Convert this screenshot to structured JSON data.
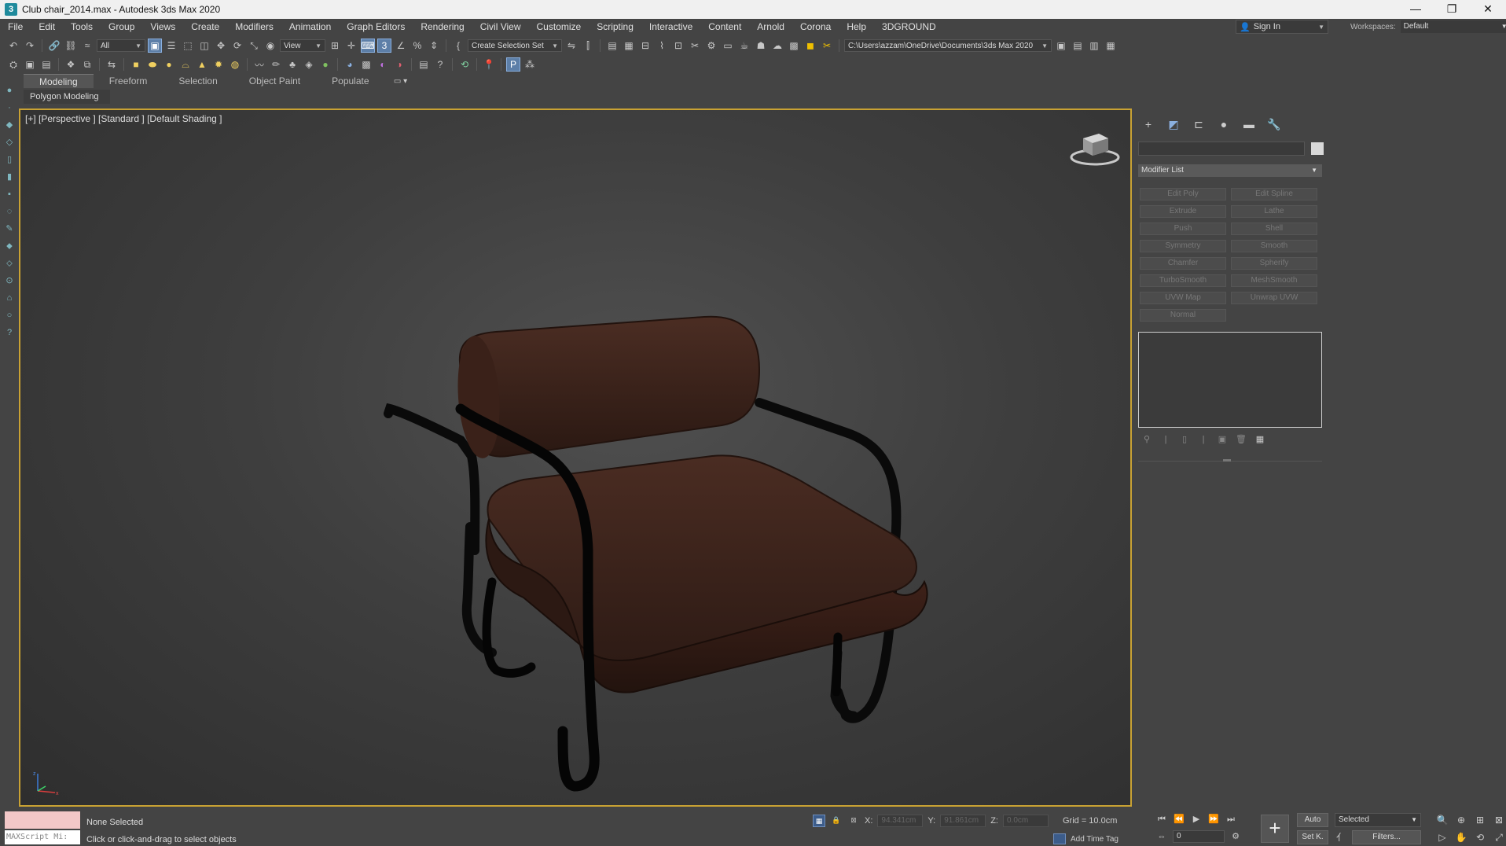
{
  "window": {
    "title": "Club chair_2014.max - Autodesk 3ds Max 2020",
    "minimize": "—",
    "restore": "❐",
    "close": "✕"
  },
  "menu": [
    "File",
    "Edit",
    "Tools",
    "Group",
    "Views",
    "Create",
    "Modifiers",
    "Animation",
    "Graph Editors",
    "Rendering",
    "Civil View",
    "Customize",
    "Scripting",
    "Interactive",
    "Content",
    "Arnold",
    "Corona",
    "Help",
    "3DGROUND"
  ],
  "account": {
    "sign_in": "Sign In"
  },
  "workspaces": {
    "label": "Workspaces:",
    "value": "Default"
  },
  "toolbar": {
    "filter": "All",
    "ref_coord": "View",
    "selection_set": "Create Selection Set",
    "project_path": "C:\\Users\\azzam\\OneDrive\\Documents\\3ds Max 2020"
  },
  "ribbon": {
    "tabs": [
      "Modeling",
      "Freeform",
      "Selection",
      "Object Paint",
      "Populate"
    ],
    "active_panel": "Polygon Modeling"
  },
  "viewport": {
    "label": "[+] [Perspective ] [Standard ] [Default Shading ]",
    "axis_x": "x",
    "axis_z": "z",
    "chair_seat_color": "#3b241c",
    "frame_color": "#0d0d0d"
  },
  "command_panel": {
    "modifier_list": "Modifier List",
    "modifier_buttons": [
      "Edit Poly",
      "Edit Spline",
      "Extrude",
      "Lathe",
      "Push",
      "Shell",
      "Symmetry",
      "Smooth",
      "Chamfer",
      "Spherify",
      "TurboSmooth",
      "MeshSmooth",
      "UVW Map",
      "Unwrap UVW",
      "Normal"
    ]
  },
  "status": {
    "maxscript_label": "MAXScript Mi:",
    "selection": "None Selected",
    "prompt": "Click or click-and-drag to select objects",
    "x_label": "X:",
    "x_value": "94.341cm",
    "y_label": "Y:",
    "y_value": "91.861cm",
    "z_label": "Z:",
    "z_value": "0.0cm",
    "grid": "Grid = 10.0cm",
    "add_time_tag": "Add Time Tag"
  },
  "animation": {
    "frame": "0",
    "auto_key": "Auto",
    "set_key": "Set K.",
    "key_filter": "Selected",
    "filters": "Filters..."
  }
}
